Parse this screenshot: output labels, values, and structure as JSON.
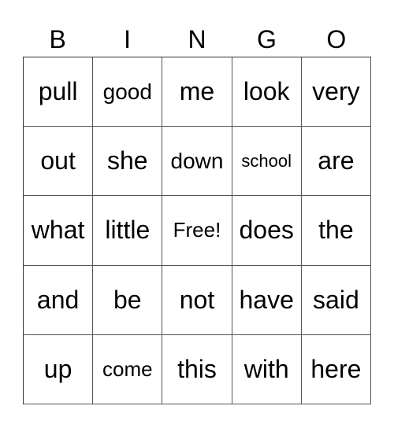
{
  "header": [
    "B",
    "I",
    "N",
    "G",
    "O"
  ],
  "rows": [
    [
      "pull",
      "good",
      "me",
      "look",
      "very"
    ],
    [
      "out",
      "she",
      "down",
      "school",
      "are"
    ],
    [
      "what",
      "little",
      "Free!",
      "does",
      "the"
    ],
    [
      "and",
      "be",
      "not",
      "have",
      "said"
    ],
    [
      "up",
      "come",
      "this",
      "with",
      "here"
    ]
  ]
}
